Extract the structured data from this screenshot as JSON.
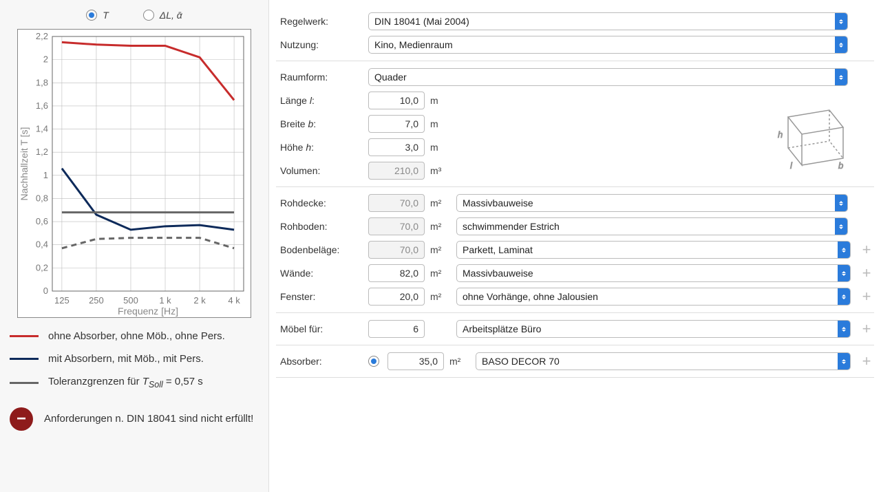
{
  "radios": {
    "t": "T",
    "dl": "ΔL, ᾱ"
  },
  "chart_data": {
    "type": "line",
    "title": "",
    "xlabel": "Frequenz [Hz]",
    "ylabel": "Nachhallzeit T [s]",
    "categories": [
      "125",
      "250",
      "500",
      "1 k",
      "2 k",
      "4 k"
    ],
    "ylim": [
      0,
      2.2
    ],
    "yticks": [
      0,
      0.2,
      0.4,
      0.6,
      0.8,
      1.0,
      1.2,
      1.4,
      1.6,
      1.8,
      2.0,
      2.2
    ],
    "series": [
      {
        "name": "red",
        "values": [
          2.15,
          2.13,
          2.12,
          2.12,
          2.02,
          1.65
        ],
        "color": "#c72c2c"
      },
      {
        "name": "navy",
        "values": [
          1.06,
          0.66,
          0.53,
          0.56,
          0.57,
          0.53
        ],
        "color": "#0d2a5a"
      },
      {
        "name": "grey-solid",
        "values": [
          0.68,
          0.68,
          0.68,
          0.68,
          0.68,
          0.68
        ],
        "color": "#666"
      },
      {
        "name": "grey-dash",
        "values": [
          0.37,
          0.45,
          0.46,
          0.46,
          0.46,
          0.37
        ],
        "color": "#666",
        "dash": true
      }
    ]
  },
  "legend": {
    "red": "ohne Absorber, ohne Möb., ohne Pers.",
    "navy": "mit Absorbern, mit Möb., mit Pers.",
    "grey_prefix": "Toleranzgrenzen für ",
    "grey_var": "T",
    "grey_sub": "Soll",
    "grey_suffix": " = 0,57 s"
  },
  "warning_text": "Anforderungen n. DIN 18041 sind nicht erfüllt!",
  "form": {
    "regelwerk": {
      "label": "Regelwerk:",
      "value": "DIN 18041 (Mai 2004)"
    },
    "nutzung": {
      "label": "Nutzung:",
      "value": "Kino, Medienraum"
    },
    "raumform": {
      "label": "Raumform:",
      "value": "Quader"
    },
    "lange": {
      "label": "Länge ",
      "var": "l",
      "value": "10,0",
      "unit": "m"
    },
    "breite": {
      "label": "Breite ",
      "var": "b",
      "value": "7,0",
      "unit": "m"
    },
    "hohe": {
      "label": "Höhe ",
      "var": "h",
      "value": "3,0",
      "unit": "m"
    },
    "volumen": {
      "label": "Volumen:",
      "value": "210,0",
      "unit": "m³"
    },
    "rohdecke": {
      "label": "Rohdecke:",
      "value": "70,0",
      "unit": "m²",
      "sel": "Massivbauweise"
    },
    "rohboden": {
      "label": "Rohboden:",
      "value": "70,0",
      "unit": "m²",
      "sel": "schwimmender Estrich"
    },
    "bodenbelage": {
      "label": "Bodenbeläge:",
      "value": "70,0",
      "unit": "m²",
      "sel": "Parkett, Laminat"
    },
    "wande": {
      "label": "Wände:",
      "value": "82,0",
      "unit": "m²",
      "sel": "Massivbauweise"
    },
    "fenster": {
      "label": "Fenster:",
      "value": "20,0",
      "unit": "m²",
      "sel": "ohne Vorhänge, ohne Jalousien"
    },
    "mobel": {
      "label": "Möbel für:",
      "value": "6",
      "sel": "Arbeitsplätze Büro"
    },
    "absorber": {
      "label": "Absorber:",
      "value": "35,0",
      "unit": "m²",
      "sel": "BASO DECOR 70"
    }
  }
}
